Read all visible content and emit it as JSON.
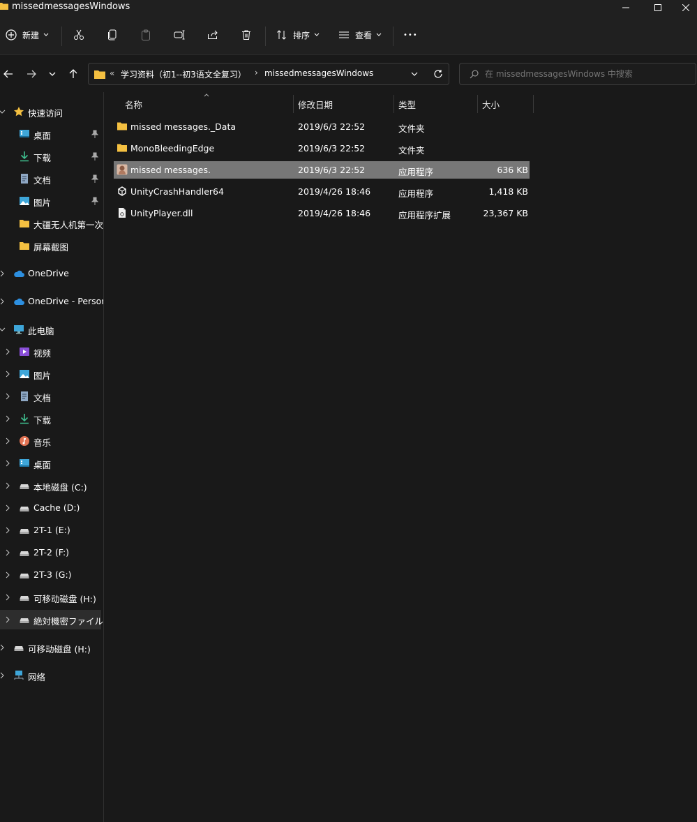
{
  "window": {
    "title": "missedmessagesWindows"
  },
  "toolbar": {
    "new_label": "新建",
    "sort_label": "排序",
    "view_label": "查看",
    "more_label": "•••"
  },
  "address": {
    "overflow": "«",
    "crumbs": [
      "学习资料（初1--初3语文全复习）",
      "missedmessagesWindows"
    ],
    "separator": "›"
  },
  "search": {
    "placeholder": "在 missedmessagesWindows 中搜索"
  },
  "sidebar": {
    "quick_access": "快速访问",
    "quick_items": [
      "桌面",
      "下载",
      "文档",
      "图片",
      "大疆无人机第一次",
      "屏幕截图"
    ],
    "onedrive": "OneDrive",
    "onedrive_personal": "OneDrive - Persor",
    "this_pc": "此电脑",
    "pc_items": [
      "视频",
      "图片",
      "文档",
      "下载",
      "音乐",
      "桌面",
      "本地磁盘 (C:)",
      "Cache (D:)",
      "2T-1 (E:)",
      "2T-2 (F:)",
      "2T-3 (G:)",
      "可移动磁盘 (H:)",
      "絶対機密ファイル"
    ],
    "removable": "可移动磁盘 (H:)",
    "network": "网络"
  },
  "columns": {
    "name": "名称",
    "modified": "修改日期",
    "type": "类型",
    "size": "大小"
  },
  "files": [
    {
      "name": "missed messages._Data",
      "modified": "2019/6/3 22:52",
      "type": "文件夹",
      "size": "",
      "icon": "folder-icon"
    },
    {
      "name": "MonoBleedingEdge",
      "modified": "2019/6/3 22:52",
      "type": "文件夹",
      "size": "",
      "icon": "folder-icon"
    },
    {
      "name": "missed messages.",
      "modified": "2019/6/3 22:52",
      "type": "应用程序",
      "size": "636 KB",
      "icon": "app-icon"
    },
    {
      "name": "UnityCrashHandler64",
      "modified": "2019/4/26 18:46",
      "type": "应用程序",
      "size": "1,418 KB",
      "icon": "unity-icon"
    },
    {
      "name": "UnityPlayer.dll",
      "modified": "2019/4/26 18:46",
      "type": "应用程序扩展",
      "size": "23,367 KB",
      "icon": "dll-file-icon"
    }
  ],
  "colors": {
    "background": "#191919",
    "selected_row": "#777777",
    "folder": "#f4c041"
  }
}
